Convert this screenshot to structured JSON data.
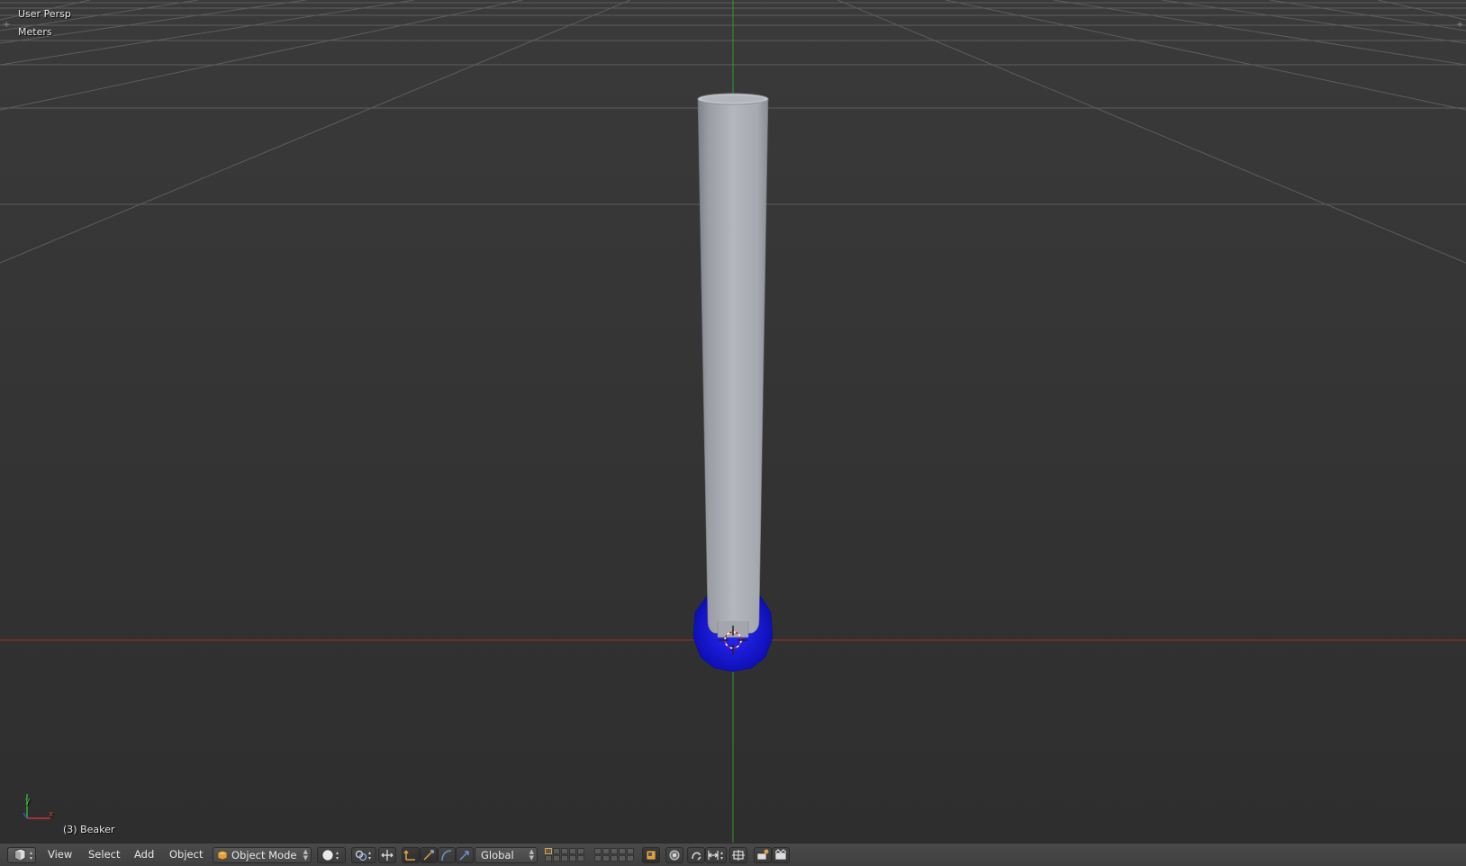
{
  "viewport": {
    "view_name": "User Persp",
    "units": "Meters",
    "object_info": "(3) Beaker",
    "axis_labels": {
      "y": "y",
      "x": "x"
    },
    "object_colors": {
      "tube": "#a0a4ab",
      "base": "#1212d4",
      "background": "#393939",
      "grid": "#5a5a5a",
      "x_axis": "#b03030",
      "y_axis": "#2e9a2e"
    }
  },
  "header": {
    "editor_type_icon": "3d-view-icon",
    "menus": {
      "view": "View",
      "select": "Select",
      "add": "Add",
      "object": "Object"
    },
    "mode": {
      "icon": "object-mode-icon",
      "label": "Object Mode"
    },
    "shading_icon": "solid-sphere-icon",
    "pivot_icon": "pivot-icon",
    "manipulator_icon": "manipulator-icon",
    "transform_icons": [
      "translate-icon",
      "rotate-icon",
      "scale-icon"
    ],
    "orientation": "Global",
    "accent": "#e0a040"
  }
}
